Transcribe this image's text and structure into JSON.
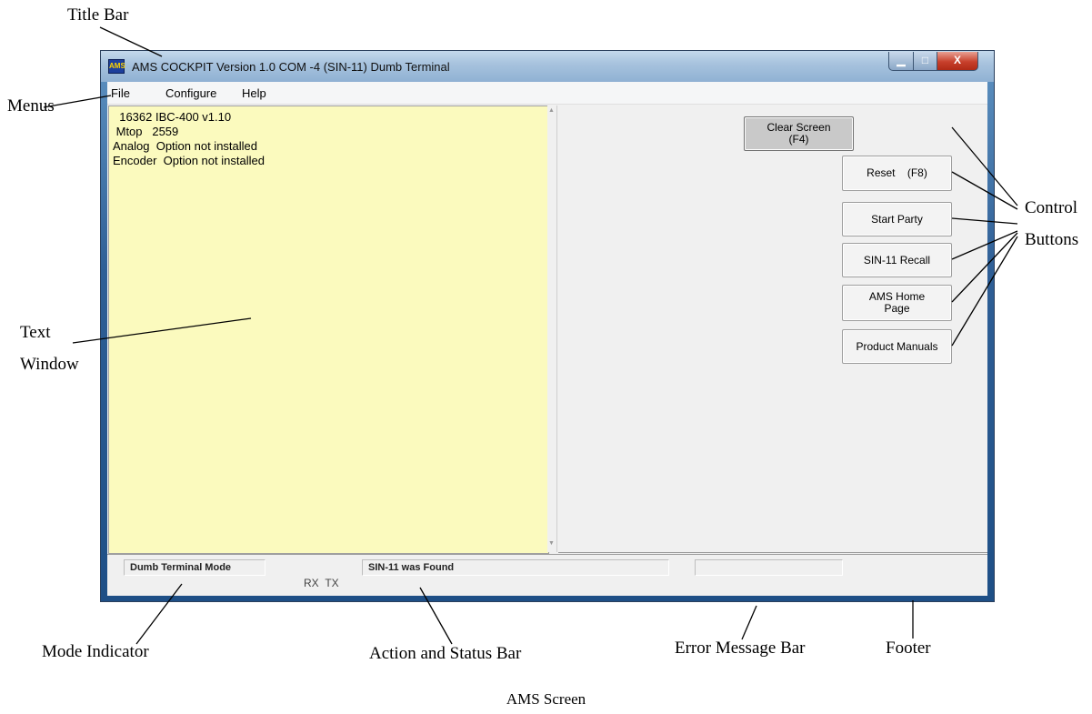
{
  "window": {
    "title": "AMS COCKPIT Version 1.0  COM -4 (SIN-11) Dumb Terminal",
    "icon": "app-logo-icon",
    "controls": [
      "minimize-icon",
      "maximize-icon",
      "close-icon"
    ]
  },
  "menus": [
    "File",
    "Configure",
    "Help"
  ],
  "text_window": {
    "lines": [
      "  16362 IBC-400 v1.10",
      " Mtop   2559",
      "Analog  Option not installed",
      "Encoder  Option not installed"
    ],
    "background": "#fbfabe"
  },
  "control_buttons": [
    {
      "label": "Clear Screen\n(F4)",
      "pressed": true
    },
    {
      "label": "Reset    (F8)",
      "pressed": false
    },
    {
      "label": "Start Party",
      "pressed": false
    },
    {
      "label": "SIN-11 Recall",
      "pressed": false
    },
    {
      "label": "AMS Home\nPage",
      "pressed": false
    },
    {
      "label": "Product Manuals",
      "pressed": false
    }
  ],
  "status": {
    "mode": "Dumb Terminal Mode",
    "rx": "RX",
    "tx": "TX",
    "action": "SIN-11 was Found",
    "error": ""
  },
  "annotations": {
    "title_bar": "Title Bar",
    "menus": "Menus",
    "text": "Text",
    "window": "Window",
    "control": "Control",
    "buttons": "Buttons",
    "mode_indicator": "Mode Indicator",
    "action_status": "Action and Status Bar",
    "error_bar": "Error Message Bar",
    "footer": "Footer"
  },
  "caption": "AMS Screen"
}
